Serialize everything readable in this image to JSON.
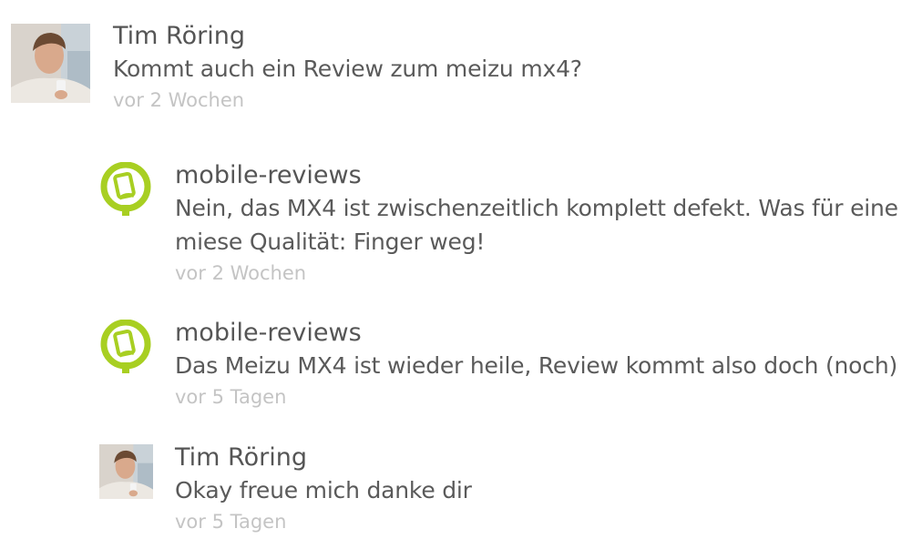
{
  "comments": [
    {
      "author": "Tim Röring",
      "text": "Kommt auch ein Review zum meizu mx4?",
      "time": "vor 2 Wochen",
      "avatar": "user-photo"
    },
    {
      "author": "mobile-reviews",
      "text": "Nein, das MX4 ist zwischenzeitlich komplett defekt. Was für eine miese Qualität: Finger weg!",
      "time": "vor 2 Wochen",
      "avatar": "mobile-reviews-logo"
    },
    {
      "author": "mobile-reviews",
      "text": "Das Meizu MX4 ist wieder heile, Review kommt also doch (noch)",
      "time": "vor 5 Tagen",
      "avatar": "mobile-reviews-logo"
    },
    {
      "author": "Tim Röring",
      "text": "Okay freue mich danke dir",
      "time": "vor 5 Tagen",
      "avatar": "user-photo"
    }
  ],
  "colors": {
    "logo_green": "#a8cf22",
    "author_text": "#555555",
    "timestamp_text": "#c4c4c4"
  }
}
